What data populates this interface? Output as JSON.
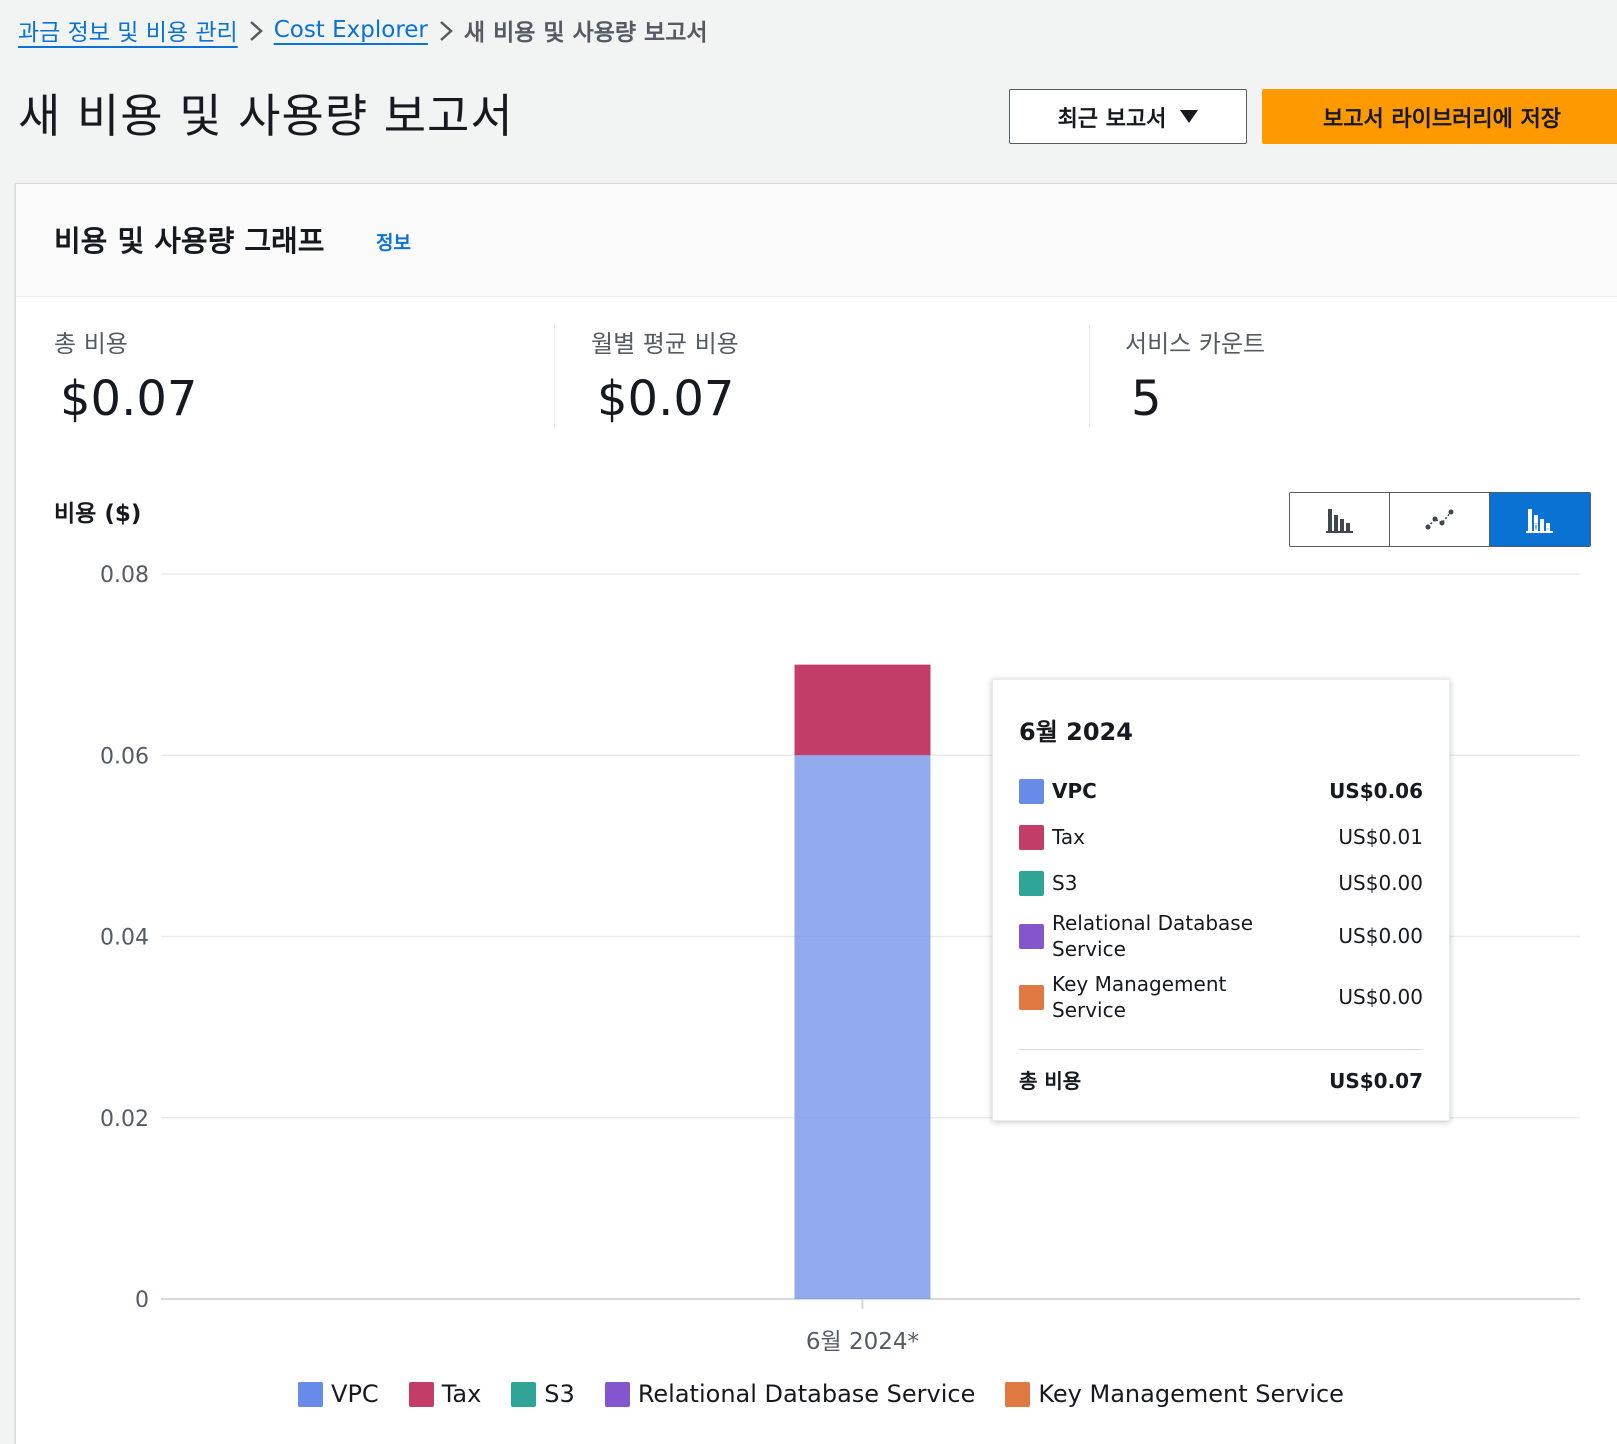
{
  "breadcrumb": {
    "items": [
      "과금 정보 및 비용 관리",
      "Cost Explorer"
    ],
    "current": "새 비용 및 사용량 보고서"
  },
  "header": {
    "title": "새 비용 및 사용량 보고서",
    "recent_reports_label": "최근 보고서",
    "save_label": "보고서 라이브러리에 저장"
  },
  "panel": {
    "title": "비용 및 사용량 그래프",
    "info_label": "정보"
  },
  "metrics": [
    {
      "label": "총 비용",
      "value": "$0.07"
    },
    {
      "label": "월별 평균 비용",
      "value": "$0.07"
    },
    {
      "label": "서비스 카운트",
      "value": "5"
    }
  ],
  "chart_view_toggle": {
    "options": [
      "bar-chart-icon",
      "line-chart-icon",
      "stacked-bar-chart-icon"
    ],
    "selected": "stacked-bar-chart-icon"
  },
  "colors": {
    "VPC": "#688ae8",
    "Tax": "#c33d69",
    "S3": "#2ea597",
    "Relational Database Service": "#8456ce",
    "Key Management Service": "#e07941",
    "accent": "#0972d3",
    "primary_button": "#ff9900"
  },
  "chart_data": {
    "type": "bar",
    "stacked": true,
    "ylabel": "비용 ($)",
    "xlabel": "",
    "ylim": [
      0,
      0.08
    ],
    "yticks": [
      "0",
      "0.02",
      "0.04",
      "0.06",
      "0.08"
    ],
    "categories": [
      "6월 2024*"
    ],
    "series": [
      {
        "name": "VPC",
        "values": [
          0.06
        ]
      },
      {
        "name": "Tax",
        "values": [
          0.01
        ]
      },
      {
        "name": "S3",
        "values": [
          0.0
        ]
      },
      {
        "name": "Relational Database Service",
        "values": [
          0.0
        ]
      },
      {
        "name": "Key Management Service",
        "values": [
          0.0
        ]
      }
    ],
    "legend": "bottom",
    "grid": true
  },
  "tooltip": {
    "title": "6월 2024",
    "rows": [
      {
        "name": "VPC",
        "value": "US$0.06"
      },
      {
        "name": "Tax",
        "value": "US$0.01"
      },
      {
        "name": "S3",
        "value": "US$0.00"
      },
      {
        "name": "Relational Database Service",
        "value": "US$0.00"
      },
      {
        "name": "Key Management Service",
        "value": "US$0.00"
      }
    ],
    "total_label": "총 비용",
    "total_value": "US$0.07"
  },
  "legend": [
    "VPC",
    "Tax",
    "S3",
    "Relational Database Service",
    "Key Management Service"
  ]
}
